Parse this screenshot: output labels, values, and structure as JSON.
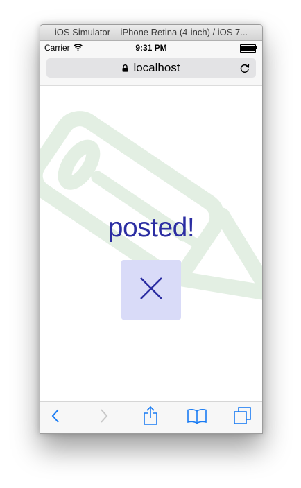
{
  "window": {
    "title": "iOS Simulator – iPhone Retina (4-inch) / iOS 7..."
  },
  "status_bar": {
    "carrier": "Carrier",
    "time": "9:31 PM",
    "battery_level": 1.0
  },
  "address_bar": {
    "url": "localhost"
  },
  "page": {
    "message": "posted!",
    "close_icon": "close-icon"
  },
  "toolbar": {
    "icons": [
      "back-icon",
      "forward-icon",
      "share-icon",
      "bookmarks-icon",
      "tabs-icon"
    ]
  },
  "colors": {
    "accent": "#1a7cf4",
    "message_text": "#2b2da2",
    "close_button_bg": "#d9dbf8",
    "pencil_watermark": "#e3efe3"
  }
}
